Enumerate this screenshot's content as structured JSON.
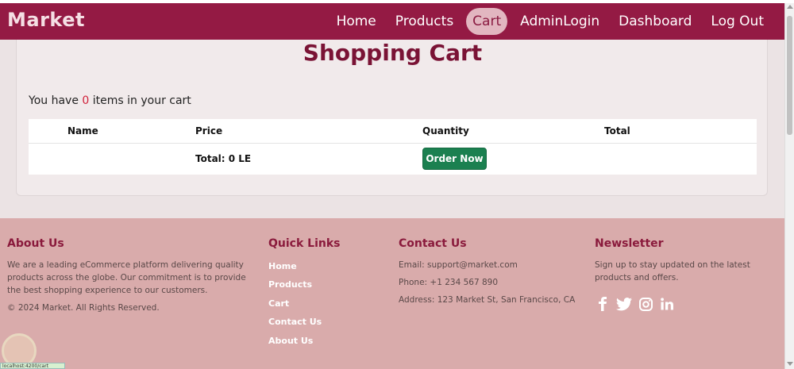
{
  "navbar": {
    "brand": "Market",
    "items": [
      {
        "label": "Home",
        "active": false
      },
      {
        "label": "Products",
        "active": false
      },
      {
        "label": "Cart",
        "active": true
      },
      {
        "label": "AdminLogin",
        "active": false
      },
      {
        "label": "Dashboard",
        "active": false
      },
      {
        "label": "Log Out",
        "active": false
      }
    ]
  },
  "cart": {
    "title": "Shopping Cart",
    "summary_prefix": "You have ",
    "count": "0",
    "summary_suffix": " items in your cart",
    "columns": [
      "Name",
      "Price",
      "Quantity",
      "Total"
    ],
    "total_label": "Total:  0 LE",
    "order_button": "Order Now"
  },
  "footer": {
    "about": {
      "title": "About Us",
      "text": "We are a leading eCommerce platform delivering quality products across the globe. Our commitment is to provide the best shopping experience to our customers.",
      "copyright": "© 2024 Market. All Rights Reserved."
    },
    "quick_links": {
      "title": "Quick Links",
      "links": [
        "Home",
        "Products",
        "Cart",
        "Contact Us",
        "About Us"
      ]
    },
    "contact": {
      "title": "Contact Us",
      "email": "Email: support@market.com",
      "phone": "Phone: +1 234 567 890",
      "address": "Address: 123 Market St, San Francisco, CA"
    },
    "newsletter": {
      "title": "Newsletter",
      "text": "Sign up to stay updated on the latest products and offers.",
      "social_icons": [
        "facebook-icon",
        "twitter-icon",
        "instagram-icon",
        "linkedin-icon"
      ]
    }
  },
  "status_bar": {
    "url": "localhost:4200/cart"
  },
  "colors": {
    "navbar": "#941a44",
    "footer": "#d9abab",
    "accent": "#7a1335",
    "order_button": "#1b8050"
  }
}
